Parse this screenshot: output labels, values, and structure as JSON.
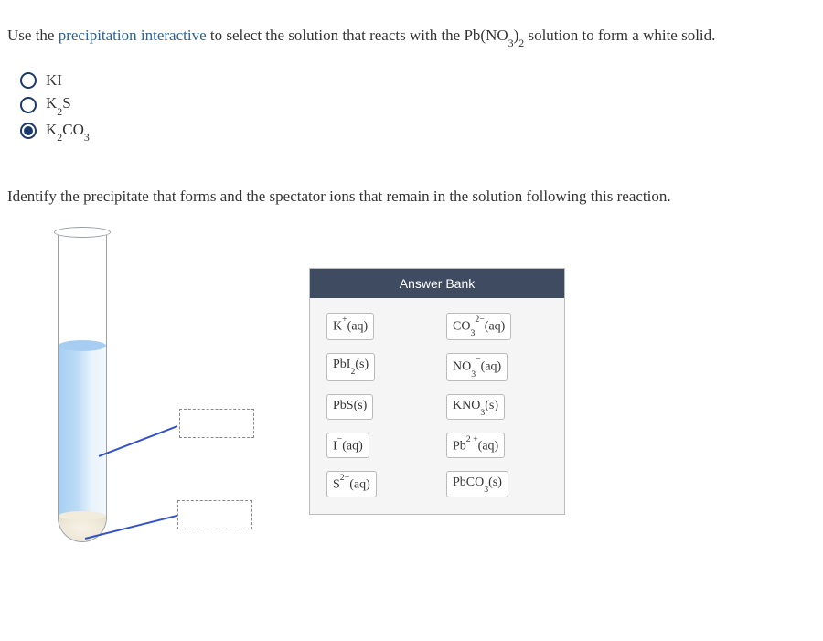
{
  "q1": {
    "prefix": "Use the ",
    "link": "precipitation interactive",
    "mid": " to select the solution that reacts with the Pb(NO",
    "sub1": "3",
    "close1": ")",
    "sub2": "2",
    "tail": " solution to form a white solid."
  },
  "options": {
    "a": {
      "text": "KI",
      "selected": false
    },
    "b": {
      "prefix": "K",
      "sub1": "2",
      "suffix": "S",
      "selected": false
    },
    "c": {
      "prefix": "K",
      "sub1": "2",
      "mid": "CO",
      "sub2": "3",
      "selected": true
    }
  },
  "q2": "Identify the precipitate that forms and the spectator ions that remain in the solution following this reaction.",
  "bank": {
    "title": "Answer Bank",
    "items": {
      "i0": {
        "pre": "K",
        "sup": "+",
        "post": "(aq)"
      },
      "i1": {
        "pre": "CO",
        "subA": "3",
        "supA": "2−",
        "post": "(aq)"
      },
      "i2": {
        "pre": "PbI",
        "subA": "2",
        "post": "(s)"
      },
      "i3": {
        "pre": "NO",
        "subA": "3",
        "supA": "−",
        "post": "(aq)"
      },
      "i4": {
        "pre": "PbS(s)"
      },
      "i5": {
        "pre": "KNO",
        "subA": "3",
        "post": "(s)"
      },
      "i6": {
        "pre": "I",
        "sup": "−",
        "post": "(aq)"
      },
      "i7": {
        "pre": "Pb",
        "supA": "2 +",
        "post": "(aq)"
      },
      "i8": {
        "pre": "S",
        "supA": "2−",
        "post": "(aq)"
      },
      "i9": {
        "pre": "PbCO",
        "subA": "3",
        "post": "(s)"
      }
    }
  }
}
